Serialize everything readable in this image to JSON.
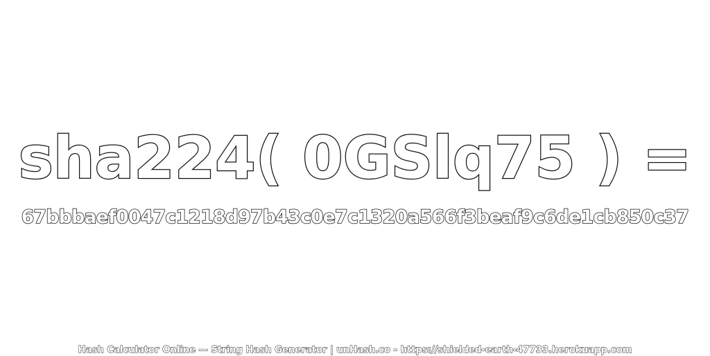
{
  "heading": "sha224( 0GSlq75 ) =",
  "hash_value": "67bbbaef0047c1218d97b43c0e7c1320a566f3beaf9c6de1cb850c37",
  "footer": "Hash Calculator Online — String Hash Generator | unHash.co - https://shielded-earth-47733.herokuapp.com",
  "colors": {
    "background": "#ffffff",
    "text_fill": "#ffffff",
    "text_outline": "#111111"
  }
}
